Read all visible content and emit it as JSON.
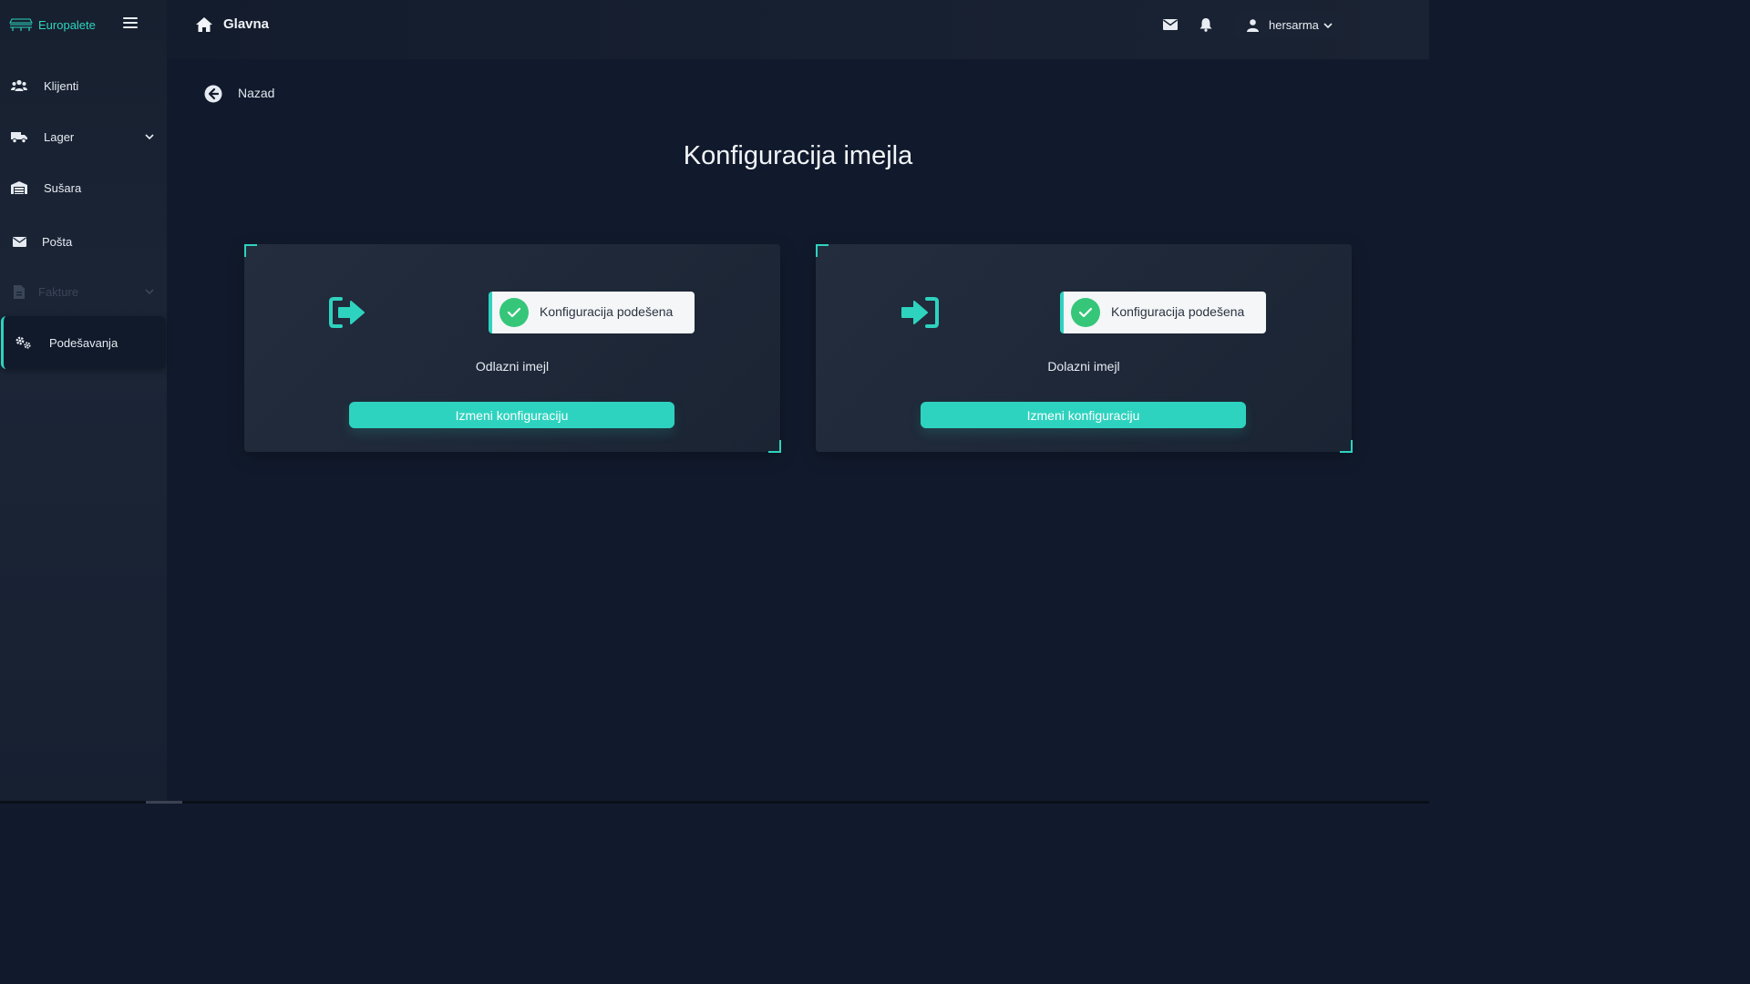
{
  "brand": {
    "name": "Europalete"
  },
  "topbar": {
    "title": "Glavna",
    "user": "hersarma"
  },
  "sidebar": {
    "items": [
      {
        "label": "Klijenti",
        "icon": "users-icon"
      },
      {
        "label": "Lager",
        "icon": "truck-icon",
        "expandable": true
      },
      {
        "label": "Sušara",
        "icon": "warehouse-icon"
      },
      {
        "label": "Pošta",
        "icon": "mail-icon"
      },
      {
        "label": "Fakture",
        "icon": "invoice-icon",
        "expandable": true,
        "disabled": true
      },
      {
        "label": "Podešavanja",
        "icon": "gears-icon",
        "active": true
      }
    ]
  },
  "main": {
    "back_label": "Nazad",
    "title": "Konfiguracija imejla",
    "cards": [
      {
        "label": "Odlazni imejl",
        "icon": "sign-out-icon",
        "status": "Konfiguracija podešena",
        "button": "Izmeni konfiguraciju"
      },
      {
        "label": "Dolazni imejl",
        "icon": "sign-in-icon",
        "status": "Konfiguracija podešena",
        "button": "Izmeni konfiguraciju"
      }
    ]
  },
  "colors": {
    "accent": "#2ed3bf",
    "background": "#111a2c",
    "success": "#35c679"
  }
}
